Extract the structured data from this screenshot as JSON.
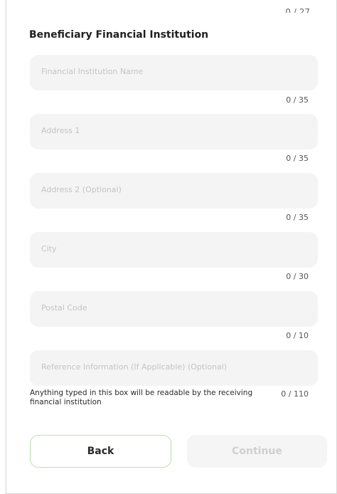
{
  "form": {
    "top_counter_partial": "0 / 27",
    "section_title": "Beneficiary Financial Institution",
    "fields": [
      {
        "placeholder": "Financial Institution Name",
        "counter": "0 / 35"
      },
      {
        "placeholder": "Address 1",
        "counter": "0 / 35"
      },
      {
        "placeholder": "Address 2 (Optional)",
        "counter": "0 / 35"
      },
      {
        "placeholder": "City",
        "counter": "0 / 30"
      },
      {
        "placeholder": "Postal Code",
        "counter": "0 / 10"
      },
      {
        "placeholder": "Reference Information (If Applicable) (Optional)",
        "counter": "0 / 110"
      }
    ],
    "reference_helper": "Anything typed in this box will be readable by the receiving financial institution"
  },
  "buttons": {
    "back_label": "Back",
    "continue_label": "Continue"
  },
  "colors": {
    "field_bg": "#f4f4f4",
    "back_border": "#bfe0b6",
    "continue_bg": "#f5f5f5",
    "continue_text": "#cfcfcf"
  }
}
